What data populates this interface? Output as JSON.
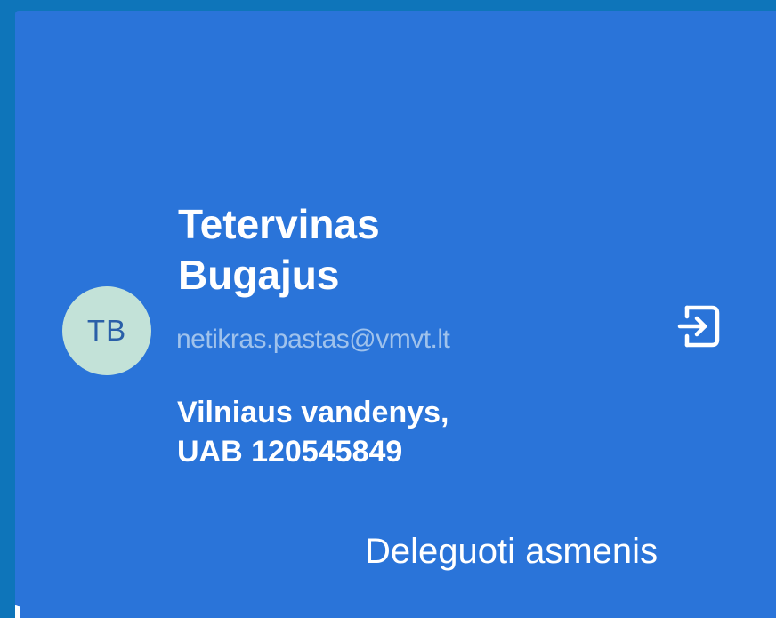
{
  "user": {
    "initials": "TB",
    "name_line1": "Tetervinas",
    "name_line2": "Bugajus",
    "email": "netikras.pastas@vmvt.lt",
    "org_line1": "Vilniaus vandenys,",
    "org_line2": "UAB 120545849"
  },
  "actions": {
    "logout_icon": "logout-icon",
    "delegate_label": "Deleguoti asmenis"
  },
  "colors": {
    "background": "#0E75BA",
    "card": "#2A74D9",
    "avatar": "#C3E2D8",
    "avatar_text": "#2A5FA8",
    "email_text": "#9FC2EC"
  }
}
